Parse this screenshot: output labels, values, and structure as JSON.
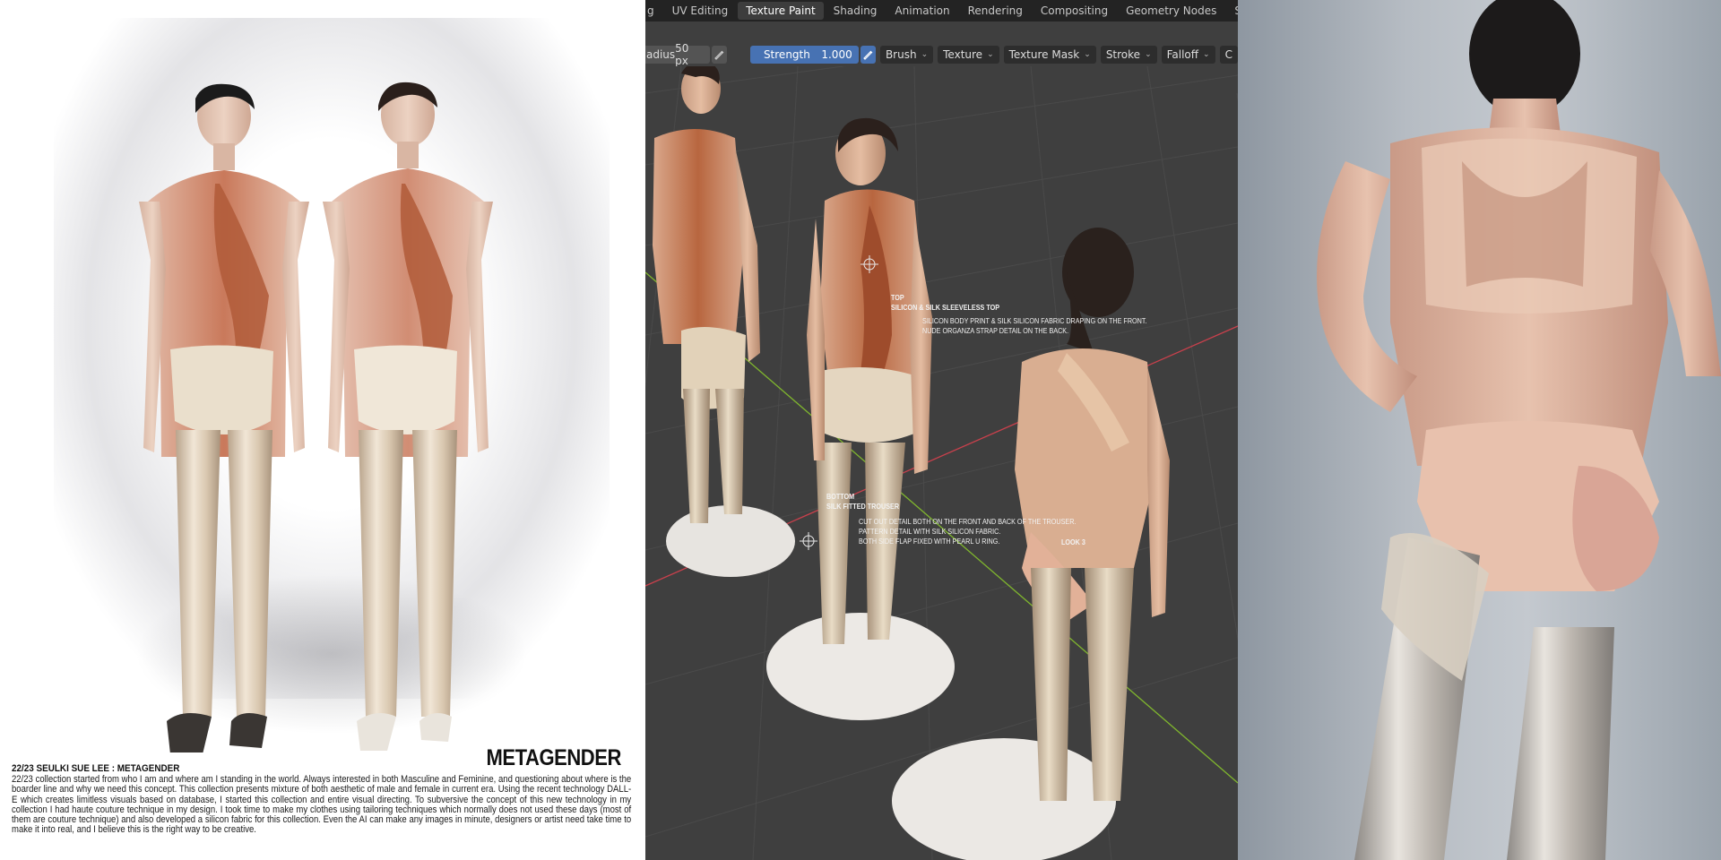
{
  "left": {
    "title": "METAGENDER",
    "heading": "22/23 SEULKI SUE LEE : METAGENDER",
    "body": "22/23 collection started from who I am and where am I standing in the world. Always interested in both Masculine and Feminine, and questioning about where is the boarder line and why we need this concept. This collection presents mixture of both aesthetic of male and female in current era. Using the recent technology DALL-E which creates limitless visuals based on database, I started this collection and entire visual directing. To subversive the concept of this new technology in my collection I had haute couture technique in my design. I took time to make my clothes using tailoring techniques which normally does not used these days (most of them are couture technique) and also developed a silicon fabric for this collection. Even the AI can make any images in minute, designers or artist need take time to make it into real, and I believe this is the right way to be creative."
  },
  "blender": {
    "workspace_tabs": [
      {
        "label": "g",
        "active": false
      },
      {
        "label": "UV Editing",
        "active": false
      },
      {
        "label": "Texture Paint",
        "active": true
      },
      {
        "label": "Shading",
        "active": false
      },
      {
        "label": "Animation",
        "active": false
      },
      {
        "label": "Rendering",
        "active": false
      },
      {
        "label": "Compositing",
        "active": false
      },
      {
        "label": "Geometry Nodes",
        "active": false
      },
      {
        "label": "Scripting",
        "active": false
      }
    ],
    "more_glyph": "+",
    "radius_label": "adius",
    "radius_value": "50 px",
    "strength_label": "Strength",
    "strength_value": "1.000",
    "dropdowns": [
      "Brush",
      "Texture",
      "Texture Mask",
      "Stroke",
      "Falloff",
      "C"
    ],
    "annotations": {
      "top_title": "TOP",
      "top_sub": "SILICON & SILK SLEEVELESS TOP",
      "top_desc_1": "SILICON BODY PRINT & SILK SILICON FABRIC DRAPING ON THE FRONT.",
      "top_desc_2": "NUDE ORGANZA STRAP DETAIL ON THE BACK.",
      "bottom_title": "BOTTOM",
      "bottom_sub": "SILK FITTED TROUSER",
      "bottom_desc_1": "CUT OUT DETAIL BOTH ON THE FRONT AND BACK OF THE TROUSER.",
      "bottom_desc_2": "PATTERN DETAIL WITH SILK SILICON FABRIC.",
      "bottom_desc_3": "BOTH SIDE FLAP FIXED WITH PEARL U RING.",
      "look": "LOOK 3"
    },
    "colors": {
      "accent": "#4772b3",
      "header": "#232323",
      "viewport": "#3f3f3f",
      "x_axis": "#c8404c",
      "y_axis": "#7fb52e"
    }
  }
}
